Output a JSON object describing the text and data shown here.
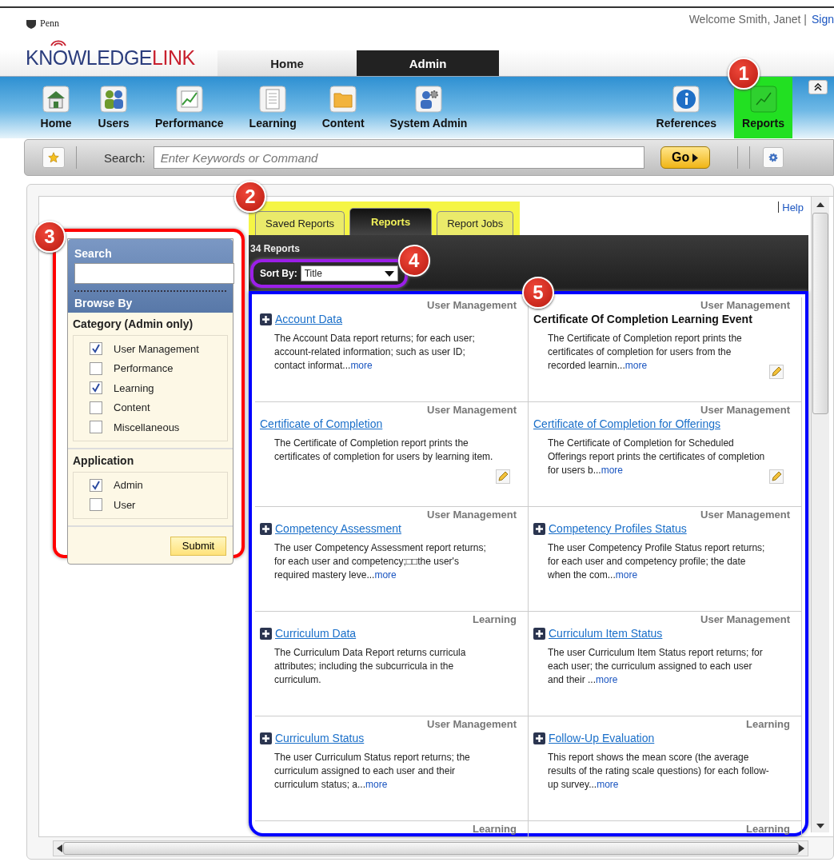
{
  "header": {
    "org": "Penn",
    "brand_main": "KNOWLEDGE",
    "brand_accent": "LINK",
    "welcome": "Welcome Smith, Janet |",
    "sign_out": "Sign",
    "tabs": [
      {
        "label": "Home",
        "selected": false
      },
      {
        "label": "Admin",
        "selected": true
      }
    ]
  },
  "nav": {
    "left_items": [
      {
        "label": "Home"
      },
      {
        "label": "Users"
      },
      {
        "label": "Performance"
      },
      {
        "label": "Learning"
      },
      {
        "label": "Content"
      },
      {
        "label": "System Admin"
      }
    ],
    "right_items": [
      {
        "label": "References"
      },
      {
        "label": "Reports",
        "annotation": {
          "callout": "1",
          "kind": "highlight",
          "color": "#22e022"
        }
      }
    ]
  },
  "toolbar": {
    "search_label": "Search:",
    "placeholder": "Enter Keywords or Command",
    "go": "Go"
  },
  "sidebar": {
    "annotation": {
      "callout": "3",
      "kind": "outline",
      "color": "#ff0000"
    },
    "search_title": "Search",
    "browse_title": "Browse By",
    "sections": [
      {
        "title": "Category (Admin only)",
        "options": [
          {
            "label": "User Management",
            "checked": true
          },
          {
            "label": "Performance",
            "checked": false
          },
          {
            "label": "Learning",
            "checked": true
          },
          {
            "label": "Content",
            "checked": false
          },
          {
            "label": "Miscellaneous",
            "checked": false
          }
        ]
      },
      {
        "title": "Application",
        "options": [
          {
            "label": "Admin",
            "checked": true
          },
          {
            "label": "User",
            "checked": false
          }
        ]
      }
    ],
    "submit": "Submit"
  },
  "main": {
    "help": "Help",
    "tabs_annotation": {
      "callout": "2",
      "kind": "highlight",
      "color": "#f5f545"
    },
    "tabs": [
      {
        "label": "Saved Reports",
        "selected": false
      },
      {
        "label": "Reports",
        "selected": true
      },
      {
        "label": "Report Jobs",
        "selected": false
      }
    ],
    "count": "34 Reports",
    "sort": {
      "label": "Sort By:",
      "value": "Title",
      "annotation": {
        "callout": "4",
        "kind": "outline",
        "color": "#9b1fe8"
      }
    },
    "grid_annotation": {
      "callout": "5",
      "kind": "outline",
      "color": "#0000ff"
    },
    "reports": [
      {
        "category": "User Management",
        "title": "Account Data",
        "linked": true,
        "expandable": true,
        "description": "The Account Data report returns; for each user; account-related information; such as user ID; contact informat...",
        "more": "more",
        "editable": false
      },
      {
        "category": "User Management",
        "title": "Certificate Of Completion Learning Event",
        "linked": false,
        "expandable": false,
        "description": "The Certificate of Completion report prints the certificates of completion for users from the recorded learnin...",
        "more": "more",
        "editable": true
      },
      {
        "category": "User Management",
        "title": "Certificate of Completion",
        "linked": true,
        "expandable": false,
        "description": "The Certificate of Completion report prints the certificates of completion for users by learning item.",
        "editable": true
      },
      {
        "category": "User Management",
        "title": "Certificate of Completion for Offerings",
        "linked": true,
        "expandable": false,
        "description": "The Certificate of Completion for Scheduled Offerings report prints the certificates of completion for users b...",
        "more": "more",
        "editable": true
      },
      {
        "category": "User Management",
        "title": "Competency Assessment",
        "linked": true,
        "expandable": true,
        "description": "The user Competency Assessment report returns; for each user and competency;□□the user's required mastery leve...",
        "more": "more",
        "editable": false
      },
      {
        "category": "User Management",
        "title": "Competency Profiles Status",
        "linked": true,
        "expandable": true,
        "description": "The user Competency Profile Status report returns; for each user and competency profile; the date when the com...",
        "more": "more",
        "editable": false
      },
      {
        "category": "Learning",
        "title": "Curriculum Data",
        "linked": true,
        "expandable": true,
        "description": "The Curriculum Data Report returns curricula attributes; including the subcurricula in the curriculum.",
        "editable": false
      },
      {
        "category": "User Management",
        "title": "Curriculum Item Status",
        "linked": true,
        "expandable": true,
        "description": "The user Curriculum Item Status report returns; for each user; the curriculum assigned to each user and their ...",
        "more": "more",
        "editable": false
      },
      {
        "category": "User Management",
        "title": "Curriculum Status",
        "linked": true,
        "expandable": true,
        "description": "The user Curriculum Status report returns; the curriculum assigned to each user and their curriculum status; a...",
        "more": "more",
        "editable": false
      },
      {
        "category": "Learning",
        "title": "Follow-Up Evaluation",
        "linked": true,
        "expandable": true,
        "description": "This report shows the mean score (the average results of the rating scale questions) for each follow-up survey...",
        "more": "more",
        "editable": false
      },
      {
        "category": "Learning"
      },
      {
        "category": "Learning"
      }
    ]
  }
}
